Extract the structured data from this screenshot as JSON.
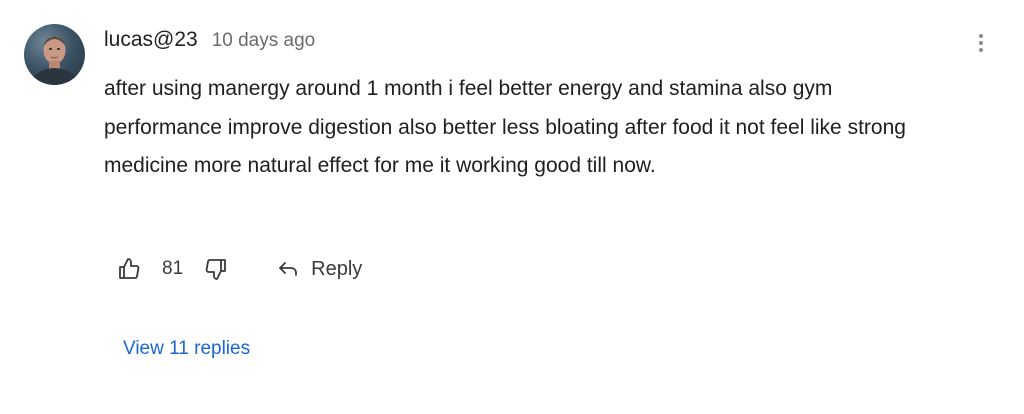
{
  "comment": {
    "avatar_alt": "user avatar",
    "username": "lucas@23",
    "timestamp": "10 days ago",
    "text": "after using manergy around 1 month i feel better energy and stamina also gym performance improve digestion also better less bloating after food it not feel like strong medicine more natural effect for me it working good till now.",
    "likes": "81",
    "reply_label": "Reply",
    "view_replies_label": "View 11 replies"
  },
  "icons": {
    "like": "thumbs-up-icon",
    "dislike": "thumbs-down-icon",
    "reply": "reply-arrow-icon",
    "menu": "more-vertical-icon"
  },
  "colors": {
    "text": "#1f1f1f",
    "muted": "#6b6b6b",
    "link": "#1a66d6"
  }
}
